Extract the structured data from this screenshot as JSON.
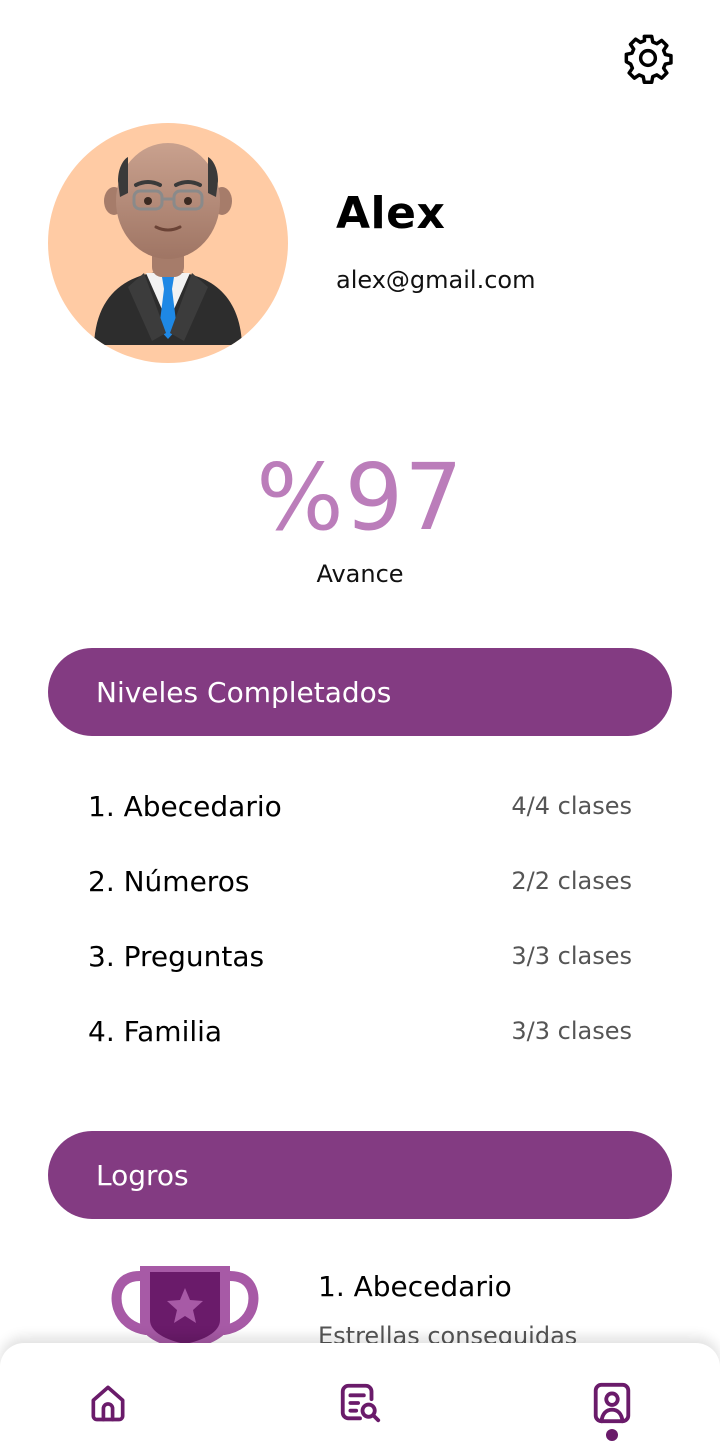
{
  "icons": {
    "settings": "gear-icon",
    "home": "home-icon",
    "search": "document-search-icon",
    "profile": "profile-icon",
    "trophy": "trophy-icon"
  },
  "colors": {
    "primary": "#833B82",
    "accent": "#BB7DBA",
    "avatar_bg": "#FFCBA4"
  },
  "profile": {
    "name": "Alex",
    "email": "alex@gmail.com"
  },
  "progress": {
    "value": "%97",
    "label": "Avance"
  },
  "levels_section": {
    "title": "Niveles Completados",
    "items": [
      {
        "name": "1. Abecedario",
        "count": "4/4 clases"
      },
      {
        "name": "2. Números",
        "count": "2/2 clases"
      },
      {
        "name": "3. Preguntas",
        "count": "3/3 clases"
      },
      {
        "name": "4. Familia",
        "count": "3/3 clases"
      }
    ]
  },
  "achievements_section": {
    "title": "Logros",
    "items": [
      {
        "title": "1. Abecedario",
        "subtitle": "Estrellas conseguidas"
      }
    ]
  },
  "bottom_nav": {
    "active": "profile"
  }
}
